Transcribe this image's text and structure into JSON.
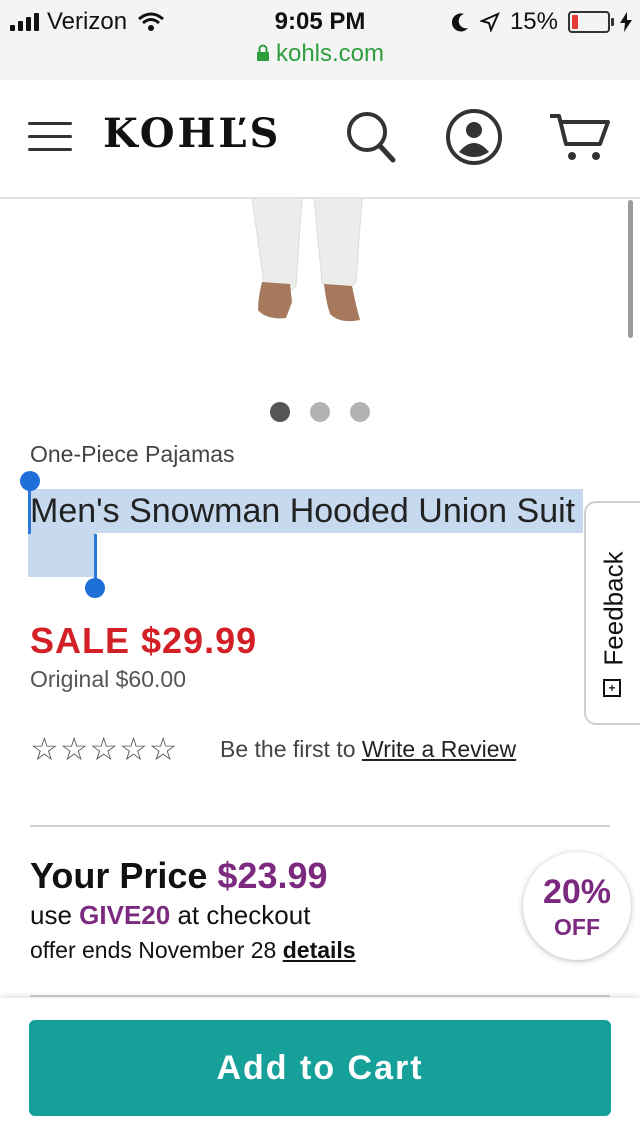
{
  "status_bar": {
    "carrier": "Verizon",
    "time": "9:05 PM",
    "battery": "15%",
    "url": "kohls.com"
  },
  "header": {
    "logo": "KOHĽS"
  },
  "product": {
    "image_dots": {
      "count": 3,
      "active": 1
    },
    "category": "One-Piece Pajamas",
    "title": "Men's Snowman Hooded Union Suit",
    "sale_price": "SALE $29.99",
    "original_price": "Original $60.00",
    "rating": {
      "stars": "☆☆☆☆☆",
      "value": 0,
      "max": 5
    },
    "review_prefix": "Be the first to ",
    "review_link": "Write a Review"
  },
  "feedback": {
    "label": "Feedback",
    "plus": "+"
  },
  "promo": {
    "your_price_label": "Your Price ",
    "your_price_amount": "$23.99",
    "use_prefix": "use ",
    "code": "GIVE20",
    "use_suffix": " at checkout",
    "offer_text": "offer ends November 28 ",
    "details_link": "details",
    "badge_percent": "20%",
    "badge_off": "OFF"
  },
  "cart": {
    "add_to_cart": "Add to Cart"
  },
  "colors": {
    "sale": "#d31f26",
    "promo": "#7b2a7f",
    "cart_button": "#16a09a",
    "selection": "#c6d9ee",
    "url_green": "#2e9e3e"
  }
}
